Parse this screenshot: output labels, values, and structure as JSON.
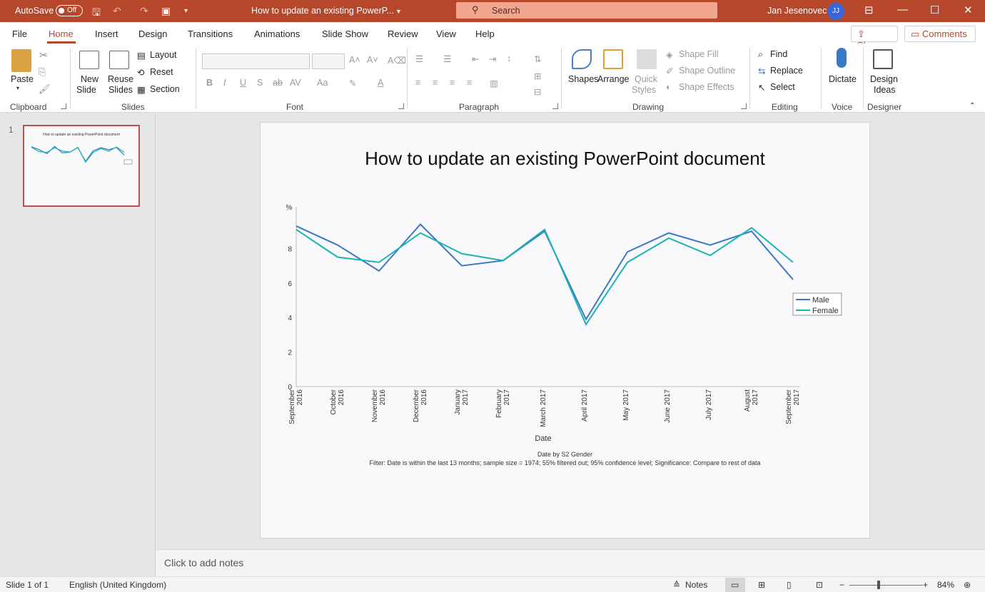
{
  "titlebar": {
    "autosave_label": "AutoSave",
    "autosave_state": "Off",
    "doc_title": "How to update an existing PowerP...",
    "search_placeholder": "Search",
    "user_name": "Jan Jesenovec",
    "user_initials": "JJ"
  },
  "menu": {
    "items": [
      "File",
      "Home",
      "Insert",
      "Design",
      "Transitions",
      "Animations",
      "Slide Show",
      "Review",
      "View",
      "Help"
    ],
    "active": "Home",
    "share_label": "Share",
    "comments_label": "Comments"
  },
  "ribbon": {
    "clipboard": {
      "label": "Clipboard",
      "paste": "Paste"
    },
    "slides": {
      "label": "Slides",
      "new_slide": [
        "New",
        "Slide"
      ],
      "reuse_slides": [
        "Reuse",
        "Slides"
      ],
      "layout": "Layout",
      "reset": "Reset",
      "section": "Section"
    },
    "font": {
      "label": "Font"
    },
    "paragraph": {
      "label": "Paragraph"
    },
    "drawing": {
      "label": "Drawing",
      "shapes": "Shapes",
      "arrange": "Arrange",
      "quick_styles": [
        "Quick",
        "Styles"
      ],
      "shape_fill": "Shape Fill",
      "shape_outline": "Shape Outline",
      "shape_effects": "Shape Effects"
    },
    "editing": {
      "label": "Editing",
      "find": "Find",
      "replace": "Replace",
      "select": "Select"
    },
    "voice": {
      "label": "Voice",
      "dictate": "Dictate"
    },
    "designer": {
      "label": "Designer",
      "design_ideas": [
        "Design",
        "Ideas"
      ]
    }
  },
  "thumbnails": {
    "slide_number": "1",
    "title": "How to update an existing PowerPoint document"
  },
  "slide": {
    "title": "How to update an existing PowerPoint document",
    "caption_line1": "Date by S2 Gender",
    "caption_line2": "Filter: Date is within the last 13 months; sample size = 1974; 55% filtered out; 95% confidence level; Significance: Compare to rest of data"
  },
  "chart_data": {
    "type": "line",
    "title": "",
    "xlabel": "Date",
    "ylabel": "%",
    "ylim": [
      0,
      10
    ],
    "yticks": [
      0,
      2,
      4,
      6,
      8
    ],
    "categories": [
      [
        "September",
        "2016"
      ],
      [
        "October",
        "2016"
      ],
      [
        "November",
        "2016"
      ],
      [
        "December",
        "2016"
      ],
      [
        "January",
        "2017"
      ],
      [
        "February",
        "2017"
      ],
      [
        "March 2017"
      ],
      [
        "April 2017"
      ],
      [
        "May 2017"
      ],
      [
        "June 2017"
      ],
      [
        "July 2017"
      ],
      [
        "August",
        "2017"
      ],
      [
        "September",
        "2017"
      ]
    ],
    "series": [
      {
        "name": "Male",
        "color": "#3c78c8",
        "values": [
          9.3,
          8.2,
          6.7,
          9.4,
          7.0,
          7.3,
          9.0,
          3.9,
          7.8,
          8.9,
          8.2,
          9.0,
          6.2
        ]
      },
      {
        "name": "Female",
        "color": "#19b4b4",
        "values": [
          9.1,
          7.5,
          7.2,
          8.9,
          7.7,
          7.3,
          9.1,
          3.6,
          7.2,
          8.6,
          7.6,
          9.2,
          7.2
        ]
      }
    ],
    "legend": "right",
    "grid": false
  },
  "notes": {
    "placeholder": "Click to add notes"
  },
  "status": {
    "slide_info": "Slide 1 of 1",
    "language": "English (United Kingdom)",
    "notes_label": "Notes",
    "zoom": "84%"
  }
}
